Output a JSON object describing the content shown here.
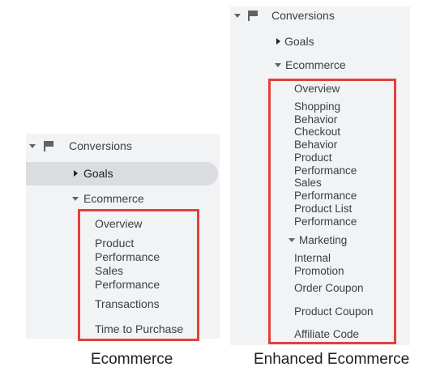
{
  "left": {
    "conversions_label": "Conversions",
    "goals_label": "Goals",
    "ecommerce_label": "Ecommerce",
    "items": [
      "Overview",
      "Product\nPerformance",
      "Sales\nPerformance",
      "Transactions",
      "Time to Purchase"
    ],
    "caption": "Ecommerce"
  },
  "right": {
    "conversions_label": "Conversions",
    "goals_label": "Goals",
    "ecommerce_label": "Ecommerce",
    "items": [
      "Overview",
      "Shopping\nBehavior",
      "Checkout\nBehavior",
      "Product\nPerformance",
      "Sales\nPerformance",
      "Product List\nPerformance"
    ],
    "marketing_label": "Marketing",
    "marketing_items": [
      "Internal\nPromotion",
      "Order Coupon",
      "Product Coupon",
      "Affiliate Code"
    ],
    "caption": "Enhanced Ecommerce"
  },
  "colors": {
    "panel_bg": "#f1f3f4",
    "highlight_bg": "#dadce0",
    "red_box": "#e2413b",
    "text": "#3c4043"
  },
  "icons": {
    "flag": "flag-icon",
    "expand": "caret-down-icon",
    "collapse": "caret-right-icon"
  }
}
